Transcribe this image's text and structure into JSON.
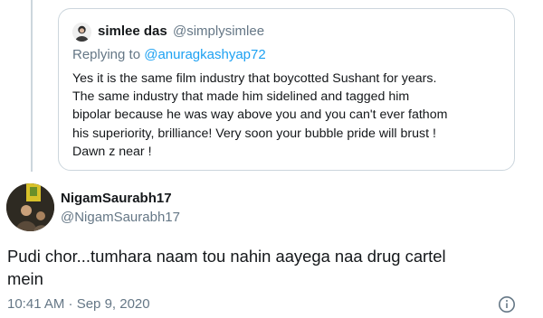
{
  "quoted_tweet": {
    "author_name": "simlee das",
    "author_handle": "@simplysimlee",
    "replying_prefix": "Replying to ",
    "replying_handle": "@anuragkashyap72",
    "body_lines": [
      "Yes it is the same film industry that boycotted Sushant for years.",
      "The same industry that made him sidelined and tagged him",
      "bipolar because he was way above you and you can't ever fathom",
      "his  superiority, brilliance! Very soon your bubble pride will brust !",
      "Dawn z near !"
    ]
  },
  "tweet": {
    "author_name": "NigamSaurabh17",
    "author_handle": "@NigamSaurabh17",
    "text_lines": [
      "Pudi chor...tumhara naam tou nahin aayega naa drug cartel",
      "mein"
    ],
    "timestamp": "10:41 AM · Sep 9, 2020"
  },
  "icons": {
    "info": "info-icon"
  },
  "colors": {
    "text_primary": "#14171a",
    "text_secondary": "#657786",
    "link": "#1da1f2",
    "border": "#ccd6dd"
  }
}
